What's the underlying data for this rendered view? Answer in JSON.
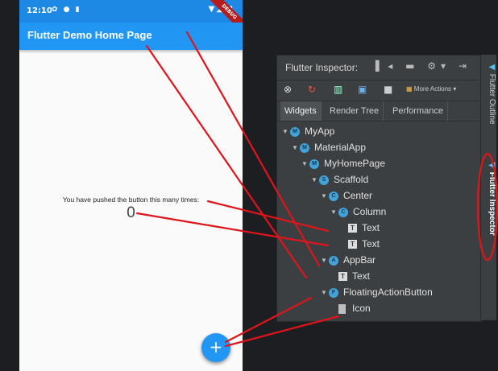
{
  "device": {
    "time": "12:10",
    "status_icons_left": "✿ ● ▮",
    "status_icons_right": "▼◢ ▮",
    "debug_banner": "DEBUG"
  },
  "app": {
    "title": "Flutter Demo Home Page",
    "message": "You have pushed the button this many times:",
    "counter": "0",
    "fab_icon": "+",
    "fab_icon_name": "plus-icon"
  },
  "inspector": {
    "title": "Flutter Inspector:",
    "toolbar_more": "More Actions",
    "tabs": [
      "Widgets",
      "Render Tree",
      "Performance"
    ],
    "active_tab": "Widgets",
    "tree": [
      {
        "label": "MyApp",
        "icon": "M",
        "kind": "circle",
        "arrow": "▼"
      },
      {
        "label": "MaterialApp",
        "icon": "M",
        "kind": "circle",
        "arrow": "▼"
      },
      {
        "label": "MyHomePage",
        "icon": "M",
        "kind": "circle",
        "arrow": "▼"
      },
      {
        "label": "Scaffold",
        "icon": "S",
        "kind": "circle",
        "arrow": "▼"
      },
      {
        "label": "Center",
        "icon": "C",
        "kind": "circle",
        "arrow": "▼"
      },
      {
        "label": "Column",
        "icon": "C",
        "kind": "circle",
        "arrow": "▼"
      },
      {
        "label": "Text",
        "icon": "T",
        "kind": "square",
        "arrow": ""
      },
      {
        "label": "Text",
        "icon": "T",
        "kind": "square",
        "arrow": ""
      },
      {
        "label": "AppBar",
        "icon": "A",
        "kind": "circle",
        "arrow": "▼"
      },
      {
        "label": "Text",
        "icon": "T",
        "kind": "square",
        "arrow": ""
      },
      {
        "label": "FloatingActionButton",
        "icon": "F",
        "kind": "circle",
        "arrow": "▼"
      },
      {
        "label": "Icon",
        "icon": "",
        "kind": "doc",
        "arrow": ""
      }
    ]
  },
  "side_tabs": {
    "outline": "Flutter Outline",
    "inspector": "Flutter Inspector"
  },
  "colors": {
    "appbar": "#2196f3",
    "statusbar": "#1e88e5",
    "annotation": "#e0141b",
    "panel": "#3c3f41"
  }
}
